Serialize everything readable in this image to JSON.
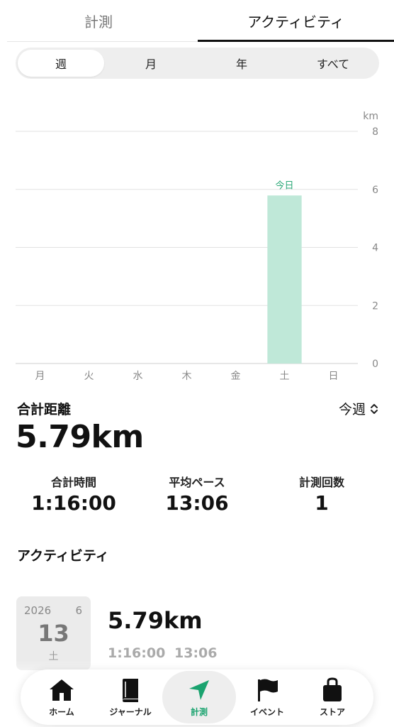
{
  "top_tabs": {
    "tab1": "計測",
    "tab2": "アクティビティ"
  },
  "segment": {
    "items": [
      "週",
      "月",
      "年",
      "すべて"
    ],
    "selected": "週"
  },
  "chart_data": {
    "type": "bar",
    "categories": [
      "月",
      "火",
      "水",
      "木",
      "金",
      "土",
      "日"
    ],
    "values": [
      0,
      0,
      0,
      0,
      0,
      5.79,
      0
    ],
    "unit": "km",
    "ylim": [
      0,
      8
    ],
    "yticks": [
      0,
      2,
      4,
      6,
      8
    ],
    "highlight_label": "今日",
    "highlight_index": 5,
    "bar_color": "#bfe8d8",
    "label_color": "#2aa877",
    "grid": true
  },
  "summary": {
    "title": "合計距離",
    "period": "今週",
    "total_distance": "5.79km",
    "stats": [
      {
        "label": "合計時間",
        "value": "1:16:00"
      },
      {
        "label": "平均ペース",
        "value": "13:06"
      },
      {
        "label": "計測回数",
        "value": "1"
      }
    ]
  },
  "activity": {
    "heading": "アクティビティ",
    "item": {
      "year": "2026",
      "month": "6",
      "day": "13",
      "weekday": "土",
      "distance": "5.79km",
      "time": "1:16:00",
      "pace": "13:06"
    }
  },
  "bottom_nav": {
    "items": [
      {
        "label": "ホーム",
        "icon": "home-icon"
      },
      {
        "label": "ジャーナル",
        "icon": "journal-icon"
      },
      {
        "label": "計測",
        "icon": "navigation-arrow-icon"
      },
      {
        "label": "イベント",
        "icon": "flag-icon"
      },
      {
        "label": "ストア",
        "icon": "shopping-bag-icon"
      }
    ],
    "active_index": 2,
    "accent": "#1aa36f"
  }
}
